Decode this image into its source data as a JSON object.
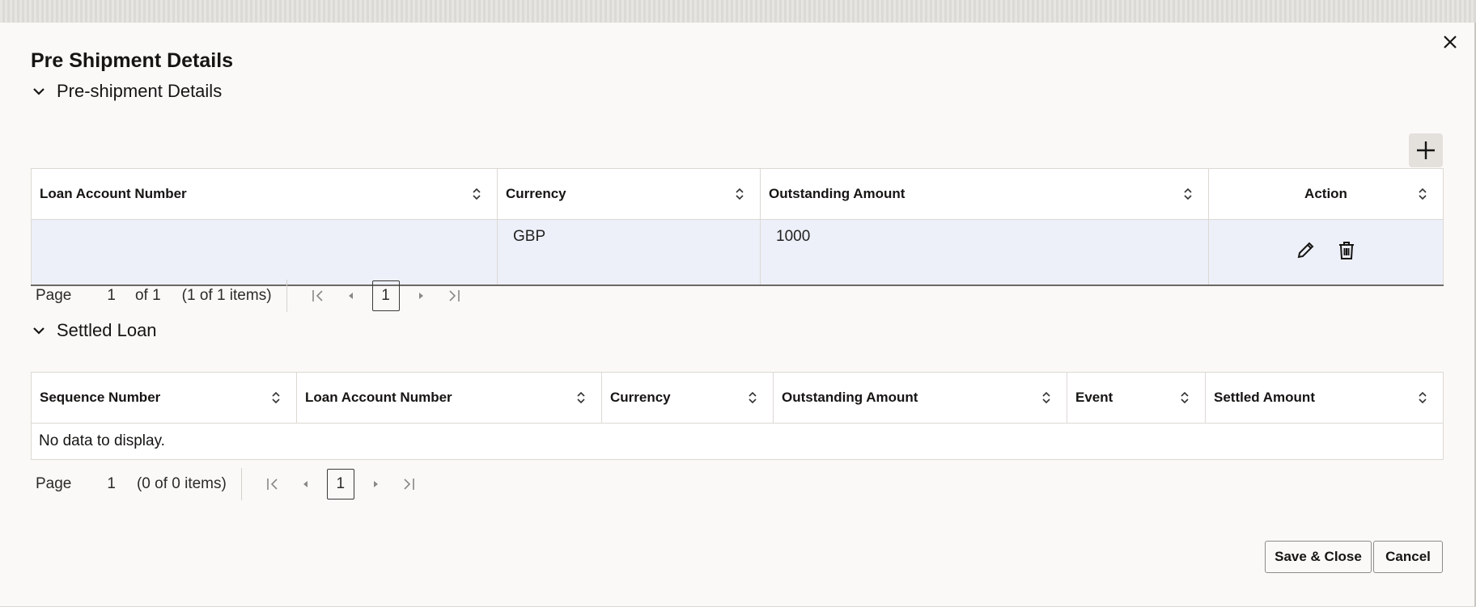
{
  "dialog": {
    "title": "Pre Shipment Details",
    "save_label": "Save & Close",
    "cancel_label": "Cancel"
  },
  "preshipment": {
    "section_title": "Pre-shipment Details",
    "columns": [
      "Loan Account Number",
      "Currency",
      "Outstanding Amount",
      "Action"
    ],
    "rows": [
      {
        "loan_account_number": "",
        "currency": "GBP",
        "outstanding_amount": "1000"
      }
    ],
    "pager": {
      "page_label": "Page",
      "page_value": "1",
      "of_text": "of 1",
      "items_text": "(1 of 1 items)",
      "current_page": "1"
    }
  },
  "settled": {
    "section_title": "Settled Loan",
    "columns": [
      "Sequence Number",
      "Loan Account Number",
      "Currency",
      "Outstanding Amount",
      "Event",
      "Settled Amount"
    ],
    "empty_text": "No data to display.",
    "pager": {
      "page_label": "Page",
      "page_value": "1",
      "items_text": "(0 of 0 items)",
      "current_page": "1"
    }
  }
}
